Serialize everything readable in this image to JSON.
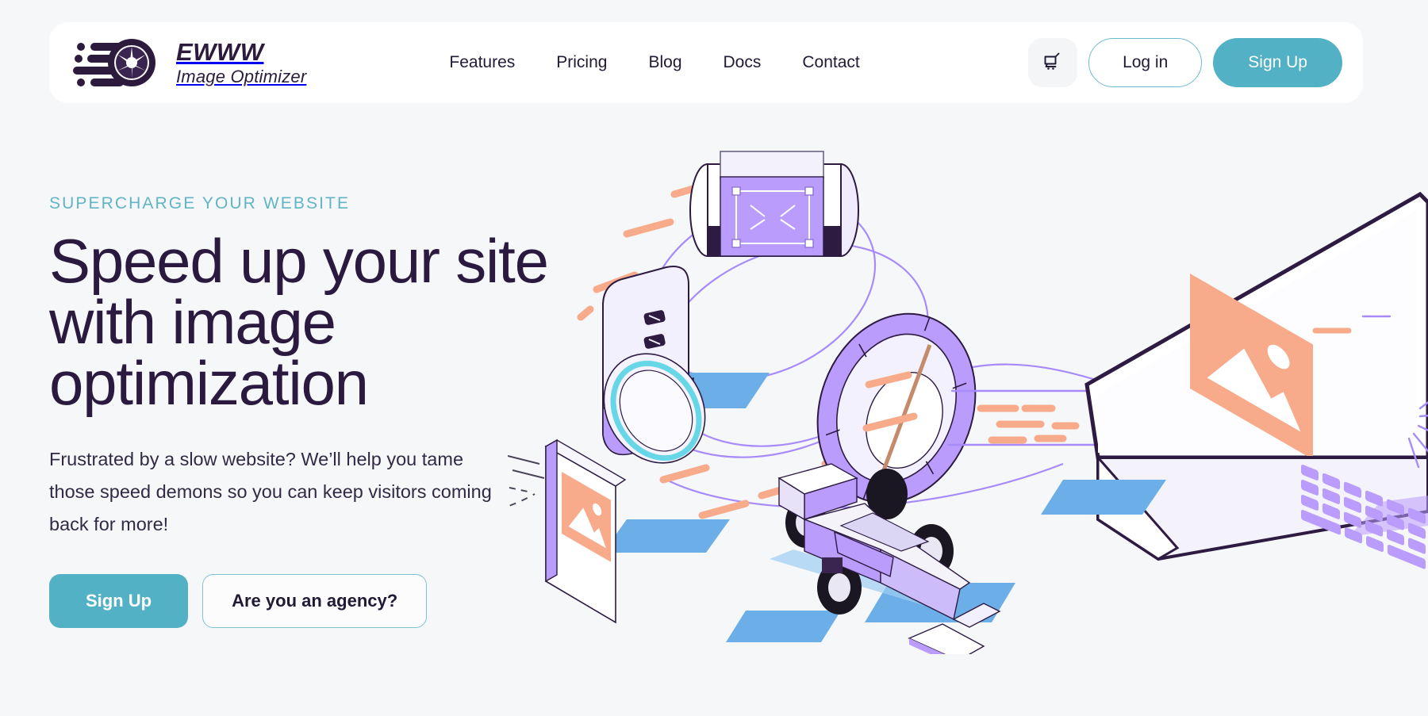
{
  "page": {
    "background_color": "#f6f7f9",
    "accent_teal": "#52b1c5",
    "heading_color": "#2b1a3f",
    "illustration_purple": "#a78bfa",
    "illustration_peach": "#f7ab8a",
    "illustration_blue": "#6cafe8",
    "illustration_outline": "#2d1b42"
  },
  "header": {
    "logo": {
      "icon": "speed-aperture-logo-icon",
      "brand": "EWWW",
      "tagline": "Image Optimizer"
    },
    "nav": [
      {
        "label": "Features"
      },
      {
        "label": "Pricing"
      },
      {
        "label": "Blog"
      },
      {
        "label": "Docs"
      },
      {
        "label": "Contact"
      }
    ],
    "actions": {
      "cart_icon": "shopping-cart-icon",
      "login_label": "Log in",
      "signup_label": "Sign Up"
    }
  },
  "hero": {
    "eyebrow": "SUPERCHARGE YOUR WEBSITE",
    "title": "Speed up your site with image optimization",
    "subtitle": "Frustrated by a slow website? We’ll help you tame those speed demons so you can keep visitors coming back for more!",
    "primary_cta": "Sign Up",
    "secondary_cta": "Are you an agency?",
    "illustration": {
      "name": "image-optimization-isometric-illustration",
      "elements": [
        "camera-lens-with-crop-handles",
        "slider-panel-card",
        "purple-ring-dial",
        "framed-photo-placeholder",
        "formula-race-car",
        "laptop-with-image-placeholder",
        "orange-speed-dashes",
        "purple-swirl-lines",
        "blue-shadow-bars"
      ]
    }
  }
}
